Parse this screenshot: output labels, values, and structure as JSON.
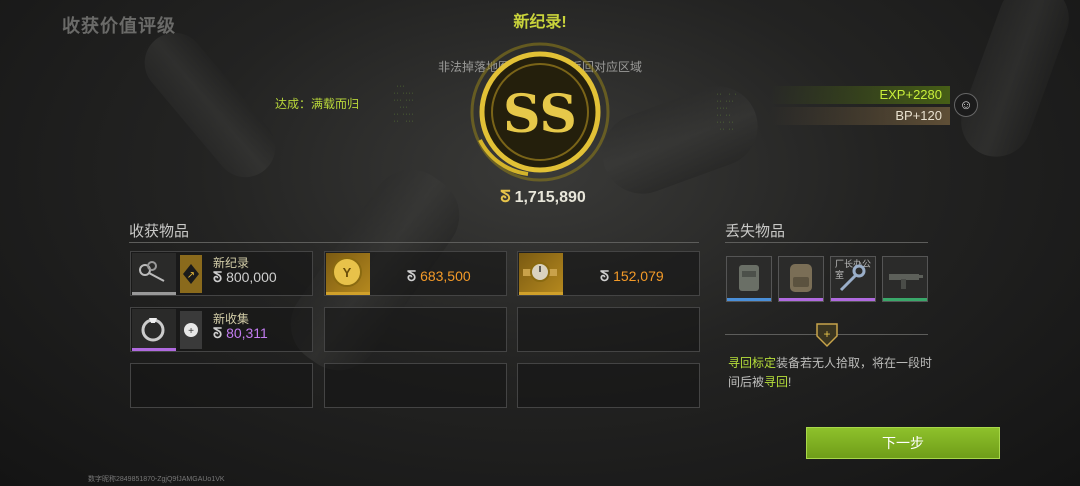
{
  "screen_title": "收获价值评级",
  "new_record": "新纪录!",
  "notice": "非法掉落地图外，已强制返回对应区域",
  "achievement": "达成：满载而归",
  "rank": "SS",
  "total_value": "1,715,890",
  "coin_symbol": "ᘕ",
  "exp": "EXP+2280",
  "bp": "BP+120",
  "harvest_title": "收获物品",
  "lost_title": "丢失物品",
  "harvest_items": [
    {
      "caption": "新纪录",
      "value": "800,000"
    },
    {
      "value": "683,500"
    },
    {
      "value": "152,079"
    },
    {
      "caption": "新收集",
      "value": "80,311"
    }
  ],
  "lost_items": [
    {
      "name": "vest-icon"
    },
    {
      "name": "backpack-icon"
    },
    {
      "label": "厂长办公室",
      "name": "key-icon"
    },
    {
      "name": "smg-icon"
    }
  ],
  "retrieve": {
    "lead": "寻回标定",
    "mid": "装备若无人拾取，将在一段时间后被",
    "tail": "寻回",
    "end": "!"
  },
  "next_button": "下一步",
  "player_id": "数字昵称2849851870-ZgjQ9fJAMGAUo1VK",
  "colors": {
    "accent_green": "#b6df3a",
    "gold": "#e6c34a",
    "orange": "#f39a28",
    "purple": "#c27cf0"
  }
}
